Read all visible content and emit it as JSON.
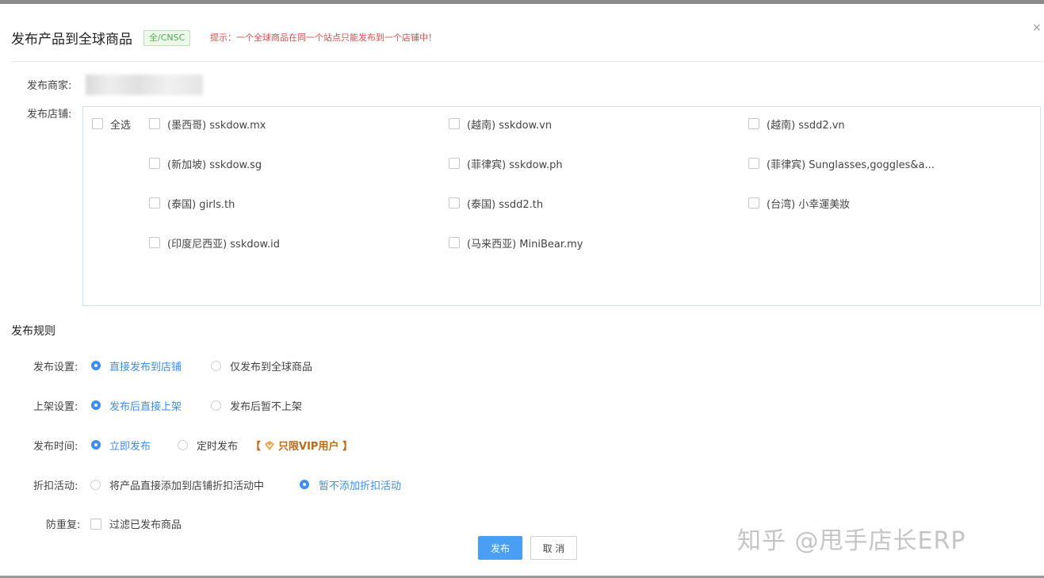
{
  "dialog": {
    "title": "发布产品到全球商品",
    "tag": "全/CNSC",
    "tip": "提示：一个全球商品在同一个站点只能发布到一个店铺中！",
    "close_icon": "×"
  },
  "merchant": {
    "label": "发布商家:"
  },
  "stores": {
    "label": "发布店铺:",
    "select_all": "全选",
    "items": [
      "(墨西哥) sskdow.mx",
      "(越南) sskdow.vn",
      "(越南) ssdd2.vn",
      "(新加坡) sskdow.sg",
      "(菲律宾) sskdow.ph",
      "(菲律宾) Sunglasses,goggles&a...",
      "(泰国) girls.th",
      "(泰国) ssdd2.th",
      "(台湾) 小幸運美妝",
      "(印度尼西亚) sskdow.id",
      "(马来西亚) MiniBear.my"
    ]
  },
  "rules": {
    "title": "发布规则",
    "publish_setting": {
      "label": "发布设置:",
      "option1": "直接发布到店铺",
      "option2": "仅发布到全球商品",
      "selected": "直接发布到店铺"
    },
    "listing_setting": {
      "label": "上架设置:",
      "option1": "发布后直接上架",
      "option2": "发布后暂不上架",
      "selected": "发布后直接上架"
    },
    "publish_time": {
      "label": "发布时间:",
      "option1": "立即发布",
      "option2": "定时发布",
      "selected": "立即发布",
      "vip_open": "【",
      "vip_text": "只限VIP用户",
      "vip_close": "】"
    },
    "discount": {
      "label": "折扣活动:",
      "option1": "将产品直接添加到店铺折扣活动中",
      "option2": "暂不添加折扣活动",
      "selected": "暂不添加折扣活动"
    },
    "dedupe": {
      "label": "防重复:",
      "option": "过滤已发布商品"
    }
  },
  "buttons": {
    "publish": "发布",
    "cancel": "取 消"
  },
  "watermark": "知乎 @甩手店长ERP",
  "colors": {
    "primary": "#4a9ff5",
    "tip_red": "#e54b4b",
    "tag_green": "#4caf50",
    "vip": "#c06a14"
  },
  "icons": {
    "vip": "vip-badge-icon",
    "close": "close-icon"
  }
}
